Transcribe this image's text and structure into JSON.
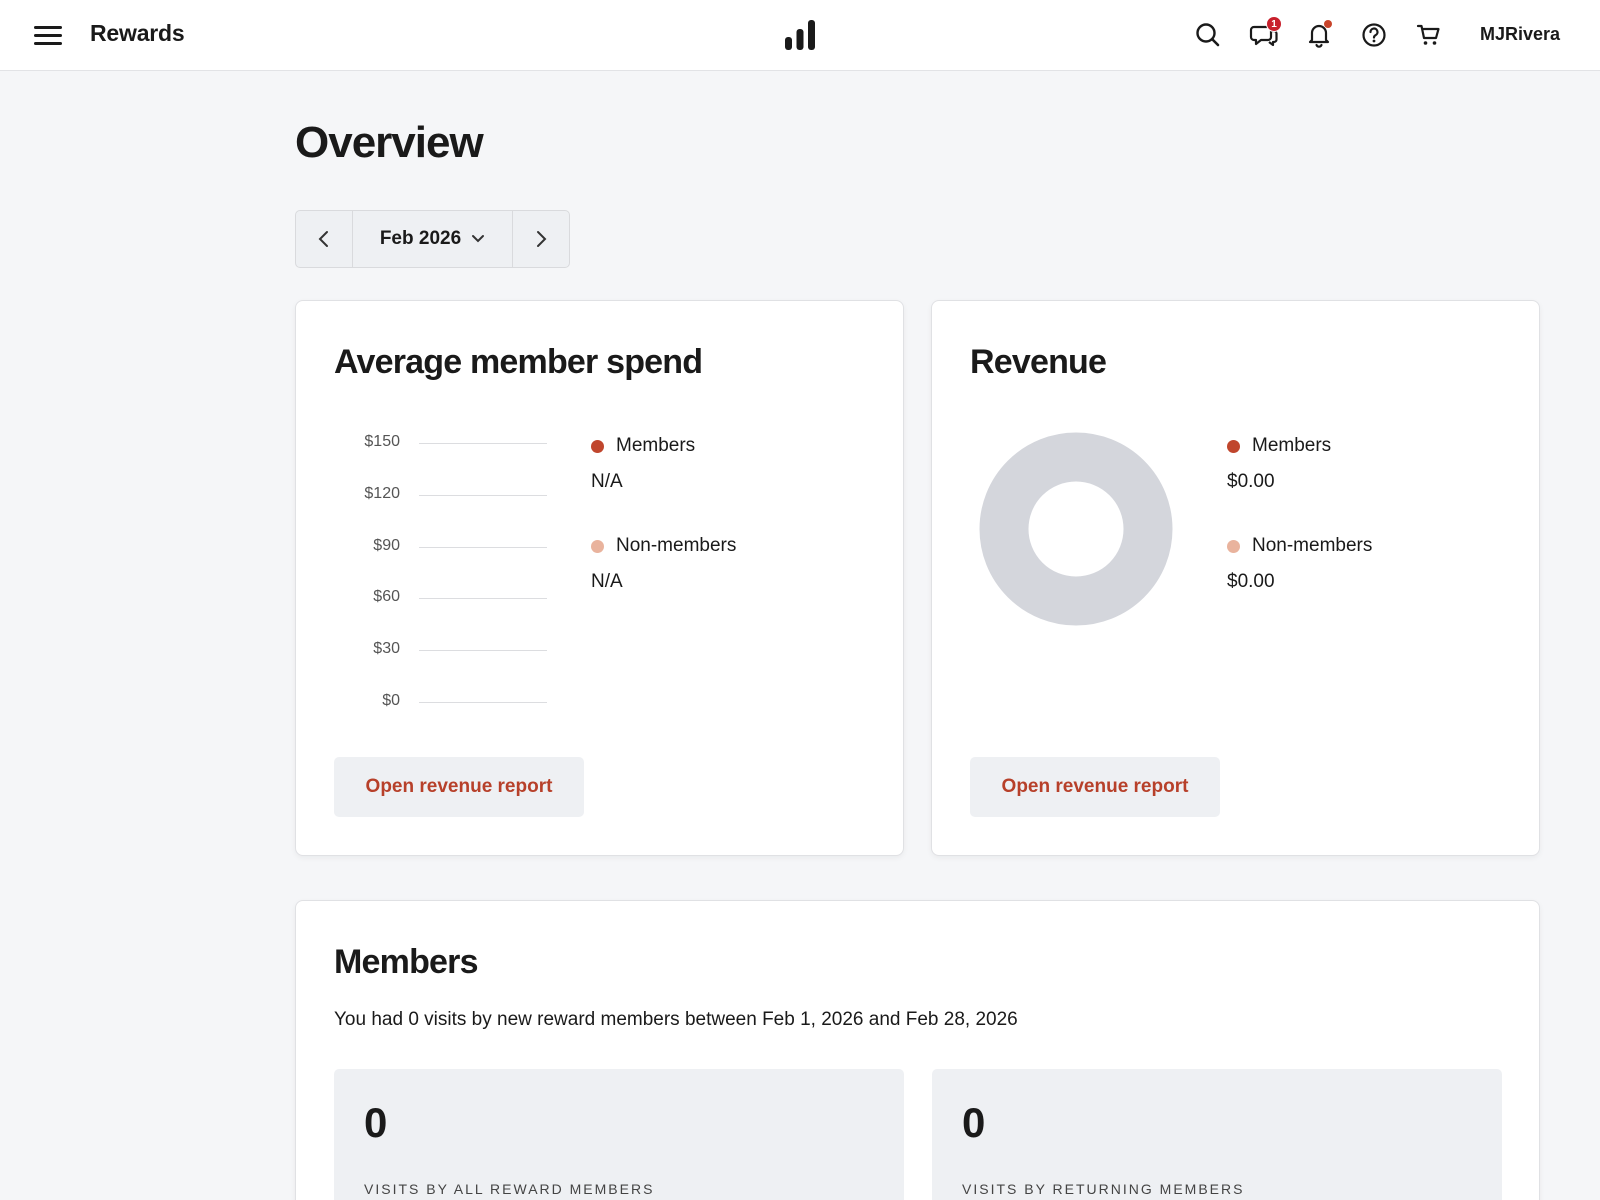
{
  "header": {
    "menu_icon": "hamburger-menu-icon",
    "app_title": "Rewards",
    "logo_icon": "bar-chart-logo-icon",
    "icons": [
      "search-icon",
      "messages-icon",
      "bell-icon",
      "help-icon",
      "cart-icon"
    ],
    "messages_badge": "1",
    "username": "MJRivera"
  },
  "page": {
    "title": "Overview"
  },
  "date_selector": {
    "label": "Feb 2026",
    "prev_icon": "chevron-left-icon",
    "next_icon": "chevron-right-icon",
    "dropdown_icon": "chevron-down-icon"
  },
  "avg_spend_card": {
    "title": "Average member spend",
    "y_ticks": [
      "$150",
      "$120",
      "$90",
      "$60",
      "$30",
      "$0"
    ],
    "legend": [
      {
        "label": "Members",
        "value": "N/A",
        "color": "#c0462d"
      },
      {
        "label": "Non-members",
        "value": "N/A",
        "color": "#e9b39d"
      }
    ],
    "button_label": "Open revenue report"
  },
  "revenue_card": {
    "title": "Revenue",
    "legend": [
      {
        "label": "Members",
        "value": "$0.00",
        "color": "#c0462d"
      },
      {
        "label": "Non-members",
        "value": "$0.00",
        "color": "#e9b39d"
      }
    ],
    "donut_color": "#d4d6dc",
    "button_label": "Open revenue report"
  },
  "members_card": {
    "title": "Members",
    "description": "You had 0 visits by new reward members between Feb 1, 2026 and Feb 28, 2026",
    "stats": [
      {
        "value": "0",
        "label": "VISITS BY ALL REWARD MEMBERS"
      },
      {
        "value": "0",
        "label": "VISITS BY RETURNING MEMBERS"
      }
    ]
  },
  "chart_data": [
    {
      "type": "bar",
      "title": "Average member spend",
      "categories": [],
      "series": [
        {
          "name": "Members",
          "values": []
        },
        {
          "name": "Non-members",
          "values": []
        }
      ],
      "ylim": [
        0,
        150
      ],
      "y_ticks": [
        0,
        30,
        60,
        90,
        120,
        150
      ],
      "grid": true,
      "legend": "right"
    },
    {
      "type": "pie",
      "title": "Revenue",
      "labels": [
        "Members",
        "Non-members"
      ],
      "values": [
        0,
        0
      ],
      "legend": "right"
    }
  ]
}
